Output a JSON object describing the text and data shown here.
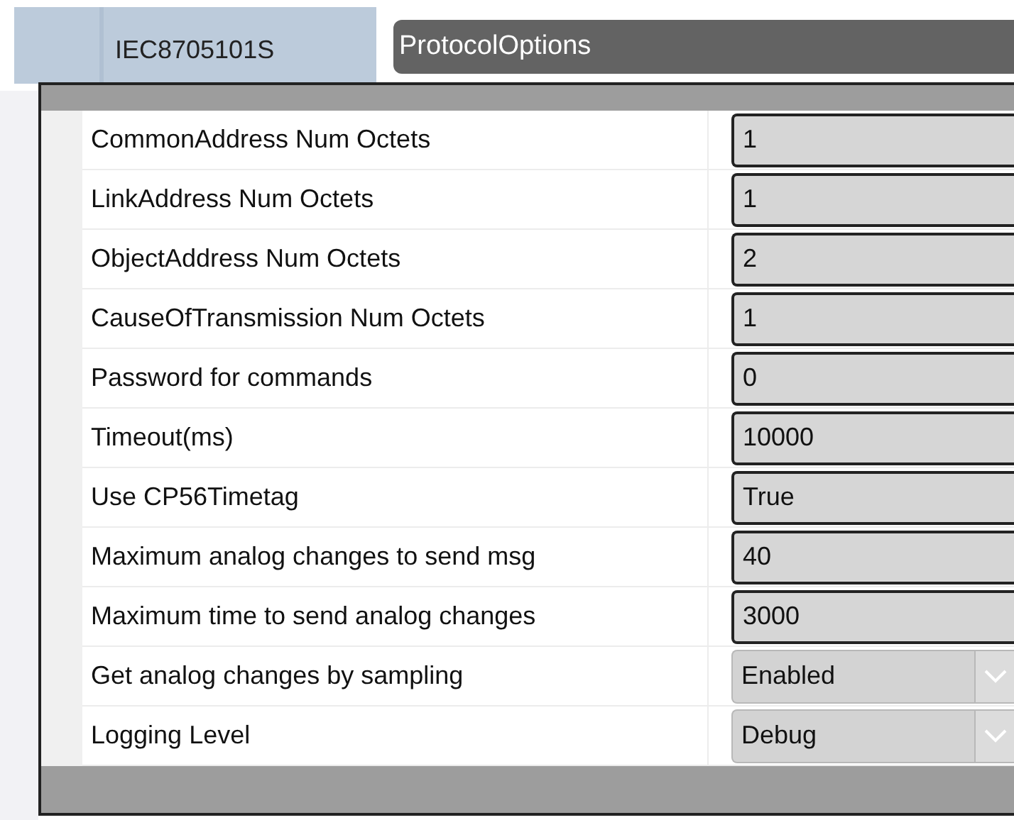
{
  "tab": {
    "label": "IEC8705101S"
  },
  "header": {
    "title": "ProtocolOptions"
  },
  "properties": [
    {
      "label": "CommonAddress Num Octets",
      "value": "1",
      "kind": "text"
    },
    {
      "label": "LinkAddress Num Octets",
      "value": "1",
      "kind": "text"
    },
    {
      "label": "ObjectAddress Num Octets",
      "value": "2",
      "kind": "text"
    },
    {
      "label": "CauseOfTransmission Num Octets",
      "value": "1",
      "kind": "text"
    },
    {
      "label": "Password for commands",
      "value": "0",
      "kind": "text"
    },
    {
      "label": "Timeout(ms)",
      "value": "10000",
      "kind": "text"
    },
    {
      "label": "Use CP56Timetag",
      "value": "True",
      "kind": "text"
    },
    {
      "label": "Maximum analog changes to send msg",
      "value": "40",
      "kind": "text"
    },
    {
      "label": "Maximum time to send analog changes",
      "value": "3000",
      "kind": "text"
    },
    {
      "label": "Get analog changes by sampling",
      "value": "Enabled",
      "kind": "combo"
    },
    {
      "label": "Logging Level",
      "value": "Debug",
      "kind": "combo"
    }
  ]
}
